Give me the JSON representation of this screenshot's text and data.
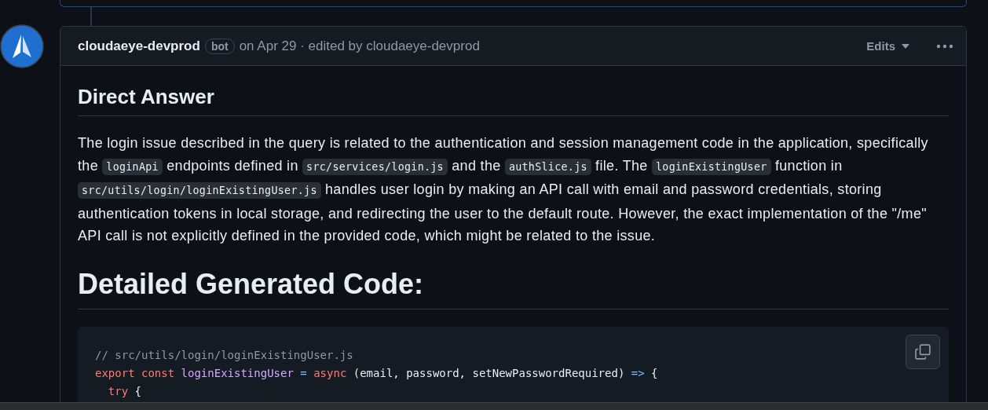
{
  "comment": {
    "author": "cloudaeye-devprod",
    "badge": "bot",
    "meta": "on Apr 29 · edited by cloudaeye-devprod",
    "edits_label": "Edits"
  },
  "body": {
    "heading": "Direct Answer",
    "paragraph": [
      {
        "kind": "text",
        "text": "The login issue described in the query is related to the authentication and session management code in the application, specifically the "
      },
      {
        "kind": "code",
        "text": "loginApi"
      },
      {
        "kind": "text",
        "text": " endpoints defined in "
      },
      {
        "kind": "code",
        "text": "src/services/login.js"
      },
      {
        "kind": "text",
        "text": " and the "
      },
      {
        "kind": "code",
        "text": "authSlice.js"
      },
      {
        "kind": "text",
        "text": " file. The "
      },
      {
        "kind": "code",
        "text": "loginExistingUser"
      },
      {
        "kind": "text",
        "text": " function in "
      },
      {
        "kind": "code",
        "text": "src/utils/login/loginExistingUser.js"
      },
      {
        "kind": "text",
        "text": " handles user login by making an API call with email and password credentials, storing authentication tokens in local storage, and redirecting the user to the default route. However, the exact implementation of the \"/me\" API call is not explicitly defined in the provided code, which might be related to the issue."
      }
    ],
    "heading_2": "Detailed Generated Code:",
    "code_lines": [
      {
        "tokens": [
          {
            "kind": "comment",
            "text": "// src/utils/login/loginExistingUser.js"
          }
        ]
      },
      {
        "tokens": [
          {
            "kind": "keyword",
            "text": "export const "
          },
          {
            "kind": "function",
            "text": "loginExistingUser"
          },
          {
            "kind": "operator",
            "text": " = "
          },
          {
            "kind": "keyword",
            "text": "async"
          },
          {
            "kind": "plain",
            "text": " (email, password, setNewPasswordRequired) "
          },
          {
            "kind": "operator",
            "text": "=>"
          },
          {
            "kind": "plain",
            "text": " {"
          }
        ]
      },
      {
        "tokens": [
          {
            "kind": "keyword",
            "text": "  try"
          },
          {
            "kind": "plain",
            "text": " {"
          }
        ]
      }
    ]
  }
}
